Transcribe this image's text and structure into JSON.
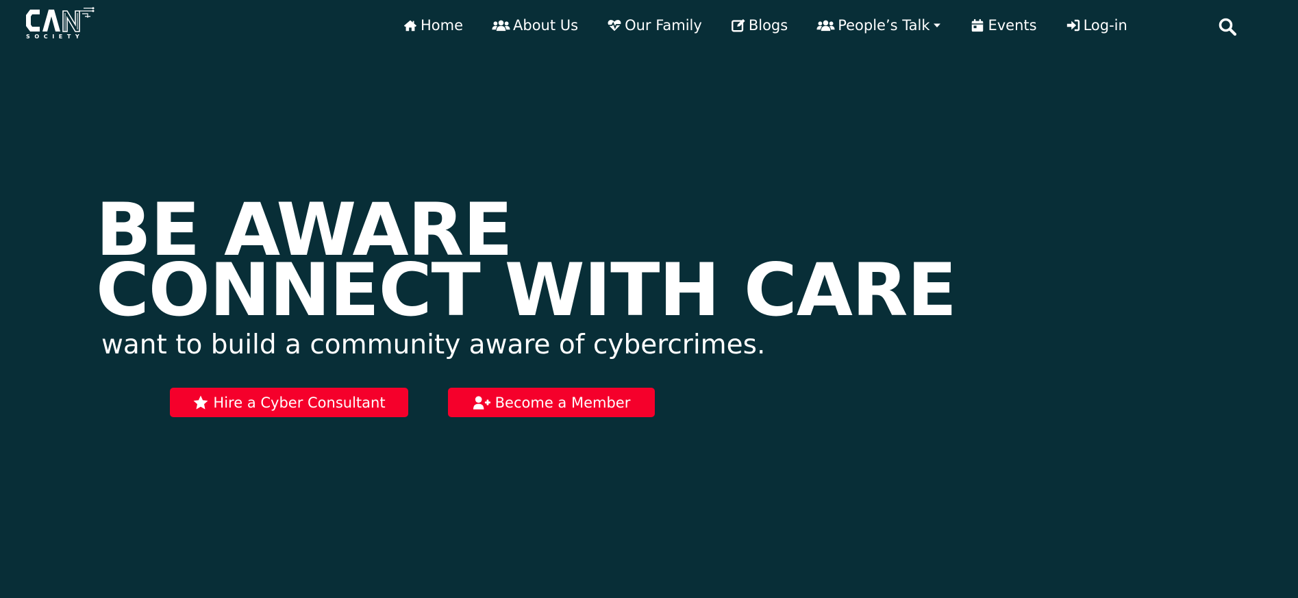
{
  "brand": {
    "logo_text": "CAN",
    "logo_subtitle": "SOCIETY"
  },
  "nav": {
    "items": [
      {
        "label": "Home",
        "icon": "home-icon"
      },
      {
        "label": "About Us",
        "icon": "users-icon"
      },
      {
        "label": "Our Family",
        "icon": "heartbeat-icon"
      },
      {
        "label": "Blogs",
        "icon": "edit-icon"
      },
      {
        "label": "People’s Talk",
        "icon": "users-icon",
        "has_dropdown": true
      },
      {
        "label": "Events",
        "icon": "calendar-icon"
      },
      {
        "label": "Log-in",
        "icon": "sign-in-icon"
      }
    ],
    "search_icon": "search-icon"
  },
  "hero": {
    "line1": "BE AWARE",
    "line2": "CONNECT WITH CARE",
    "tagline": "want to build a community aware of cybercrimes."
  },
  "buttons": {
    "hire_label": "Hire a Cyber Consultant",
    "hire_icon": "star-icon",
    "member_label": "Become a Member",
    "member_icon": "user-plus-icon"
  },
  "colors": {
    "background": "#082e37",
    "accent": "#f5002b",
    "text": "#ffffff"
  }
}
